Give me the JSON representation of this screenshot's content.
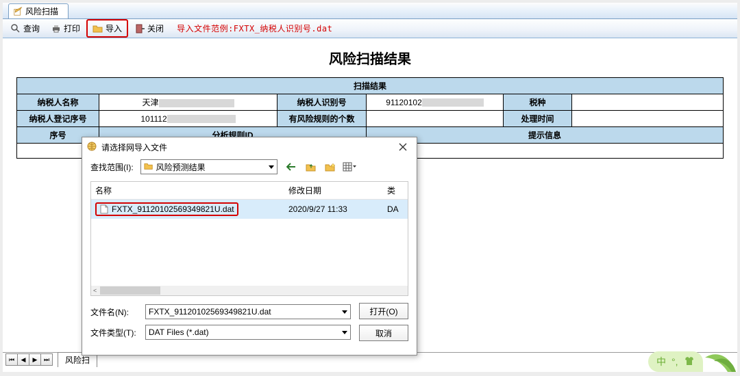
{
  "tab": {
    "label": "风险扫描"
  },
  "toolbar": {
    "query": "查询",
    "print": "打印",
    "import": "导入",
    "close": "关闭",
    "hint": "导入文件范例:FXTX_纳税人识别号.dat"
  },
  "results": {
    "title": "风险扫描结果",
    "section_header": "扫描结果",
    "row1": {
      "label1": "纳税人名称",
      "val1": "天津",
      "label2": "纳税人识别号",
      "val2": "91120102",
      "label3": "税种"
    },
    "row2": {
      "label1": "纳税人登记序号",
      "val1": "101112",
      "label2": "有风险规则的个数",
      "label3": "处理时间"
    },
    "cols": {
      "seq": "序号",
      "ruleid": "分析规则ID",
      "hint": "提示信息"
    }
  },
  "nav": {
    "sheet": "风险扫"
  },
  "dialog": {
    "title": "请选择网导入文件",
    "lookin_label": "查找范围(I):",
    "lookin_value": "风险预测结果",
    "cols": {
      "name": "名称",
      "date": "修改日期",
      "type": "类"
    },
    "files": [
      {
        "name": "FXTX_91120102569349821U.dat",
        "date": "2020/9/27 11:33",
        "type": "DA"
      }
    ],
    "filename_label": "文件名(N):",
    "filename_value": "FXTX_91120102569349821U.dat",
    "filetype_label": "文件类型(T):",
    "filetype_value": "DAT Files (*.dat)",
    "open": "打开(O)",
    "cancel": "取消"
  },
  "ime": {
    "mode": "中",
    "punct": "°,"
  }
}
